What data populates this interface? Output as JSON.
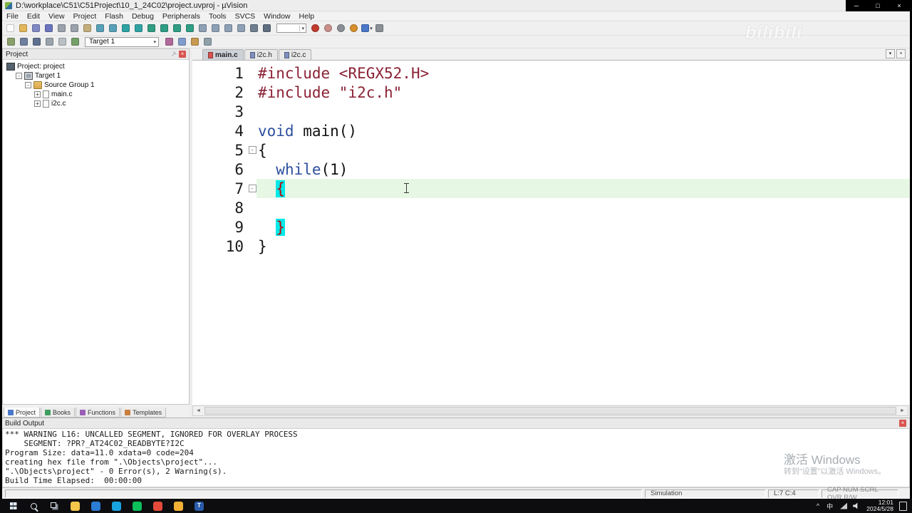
{
  "icons": {
    "minimize": "─",
    "maximize": "□",
    "close": "×",
    "caret_down": "▾",
    "pin": "⊤",
    "scroll_left": "◄",
    "scroll_right": "►",
    "chevron_up": "^"
  },
  "window": {
    "title": "D:\\workplace\\C51\\C51Project\\10_1_24C02\\project.uvproj - µVision"
  },
  "menu": {
    "items": [
      "File",
      "Edit",
      "View",
      "Project",
      "Flash",
      "Debug",
      "Peripherals",
      "Tools",
      "SVCS",
      "Window",
      "Help"
    ]
  },
  "toolbar1": {
    "iconsA": [
      {
        "name": "new-file",
        "color": "#fcfcfc"
      },
      {
        "name": "open-folder",
        "color": "#e3b65a"
      },
      {
        "name": "save",
        "color": "#8089c6"
      },
      {
        "name": "save-all",
        "color": "#6a75bd"
      },
      {
        "name": "cut",
        "color": "#9aa3ac"
      },
      {
        "name": "copy",
        "color": "#9aa3ac"
      },
      {
        "name": "paste",
        "color": "#c4ad7c"
      },
      {
        "name": "undo",
        "color": "#58a0b8"
      },
      {
        "name": "redo",
        "color": "#58a0b8"
      },
      {
        "name": "nav-back",
        "color": "#2fa3a3"
      },
      {
        "name": "nav-forward",
        "color": "#2fa3a3"
      },
      {
        "name": "bookmark-toggle",
        "color": "#2f9e84"
      },
      {
        "name": "bookmark-prev",
        "color": "#2f9e84"
      },
      {
        "name": "bookmark-next",
        "color": "#2f9e84"
      },
      {
        "name": "bookmark-clear-all",
        "color": "#2f9e84"
      },
      {
        "name": "indent-right",
        "color": "#8ea0b5"
      },
      {
        "name": "indent-left",
        "color": "#8ea0b5"
      },
      {
        "name": "comment-selection",
        "color": "#8ea0b5"
      },
      {
        "name": "uncomment-selection",
        "color": "#8ea0b5"
      },
      {
        "name": "find-in-files",
        "color": "#6f7f8f"
      },
      {
        "name": "find",
        "color": "#5f6f7f"
      }
    ],
    "iconsB": [
      {
        "name": "insert-breakpoint",
        "color": "#c23b2e",
        "round": true
      },
      {
        "name": "disable-breakpoint",
        "color": "#c98f8a",
        "round": true
      },
      {
        "name": "kill-all-breakpoints",
        "color": "#8a8f96",
        "round": true
      },
      {
        "name": "enable-all-breakpoints",
        "color": "#d78f2a",
        "round": true
      },
      {
        "name": "debug-windows",
        "color": "#4a78c8",
        "caret": "▾"
      },
      {
        "name": "configure-tools",
        "color": "#8a8f96"
      }
    ]
  },
  "toolbar2": {
    "target": "Target 1",
    "iconsA": [
      {
        "name": "translate-file",
        "color": "#8aa06a"
      },
      {
        "name": "build",
        "color": "#6f7f9f"
      },
      {
        "name": "rebuild-all",
        "color": "#5f7090"
      },
      {
        "name": "batch-build",
        "color": "#9aa3ac"
      },
      {
        "name": "stop-build",
        "color": "#b9bfc5"
      },
      {
        "name": "download-to-flash",
        "color": "#76a06a"
      }
    ],
    "iconsB": [
      {
        "name": "options-for-target",
        "color": "#b06a9a"
      },
      {
        "name": "manage-project-items",
        "color": "#7f9ccc"
      },
      {
        "name": "manage-run-time-environment",
        "color": "#c89a50"
      },
      {
        "name": "file-extensions",
        "color": "#8fa0aa"
      }
    ]
  },
  "project_panel": {
    "title": "Project",
    "tree": [
      {
        "indent": 0,
        "icon": "workspace",
        "label": "Project: project"
      },
      {
        "indent": 1,
        "expander": "-",
        "icon": "target",
        "label": "Target 1"
      },
      {
        "indent": 2,
        "expander": "-",
        "icon": "folder",
        "label": "Source Group 1"
      },
      {
        "indent": 3,
        "expander": "+",
        "icon": "file",
        "label": "main.c"
      },
      {
        "indent": 3,
        "expander": "+",
        "icon": "file",
        "label": "i2c.c"
      }
    ]
  },
  "editor": {
    "tabs": [
      {
        "label": "main.c",
        "active": true,
        "icon": "#d9534f"
      },
      {
        "label": "i2c.h",
        "active": false,
        "icon": "#7f8fbf"
      },
      {
        "label": "i2c.c",
        "active": false,
        "icon": "#7f8fbf"
      }
    ],
    "lines": [
      {
        "num": 1,
        "tokens": [
          {
            "text": "#include ",
            "color": "#8b2235"
          },
          {
            "text": "<REGX52.H>",
            "color": "#8b2235"
          }
        ]
      },
      {
        "num": 2,
        "tokens": [
          {
            "text": "#include ",
            "color": "#8b2235"
          },
          {
            "text": "\"i2c.h\"",
            "color": "#8b2235"
          }
        ]
      },
      {
        "num": 3,
        "tokens": []
      },
      {
        "num": 4,
        "tokens": [
          {
            "text": "void",
            "color": "#2d4f9e"
          },
          {
            "text": " main()"
          }
        ]
      },
      {
        "num": 5,
        "fold": "-",
        "tokens": [
          {
            "text": "{"
          }
        ]
      },
      {
        "num": 6,
        "tokens": [
          {
            "text": "  "
          },
          {
            "text": "while",
            "color": "#2d4f9e"
          },
          {
            "text": "(1)"
          }
        ]
      },
      {
        "num": 7,
        "fold": "-",
        "bg": "#e6f8e4",
        "tokens": [
          {
            "text": "  "
          },
          {
            "text": "{",
            "color": "#c00000",
            "bg": "#00e8e8"
          }
        ]
      },
      {
        "num": 8,
        "tokens": []
      },
      {
        "num": 9,
        "tokens": [
          {
            "text": "  "
          },
          {
            "text": "}",
            "color": "#c00000",
            "bg": "#00e8e8"
          }
        ]
      },
      {
        "num": 10,
        "tokens": [
          {
            "text": "}"
          }
        ]
      }
    ]
  },
  "bottom_tabs": {
    "items": [
      {
        "label": "Project",
        "active": true,
        "icon": "#4a78c8"
      },
      {
        "label": "Books",
        "active": false,
        "icon": "#3f9e5f"
      },
      {
        "label": "Functions",
        "active": false,
        "icon": "#9a5fb5"
      },
      {
        "label": "Templates",
        "active": false,
        "icon": "#c87f3f"
      }
    ]
  },
  "build_output": {
    "title": "Build Output",
    "lines": [
      "*** WARNING L16: UNCALLED SEGMENT, IGNORED FOR OVERLAY PROCESS",
      "    SEGMENT: ?PR?_AT24C02_READBYTE?I2C",
      "Program Size: data=11.0 xdata=0 code=204",
      "creating hex file from \".\\Objects\\project\"...",
      "\".\\Objects\\project\" - 0 Error(s), 2 Warning(s).",
      "Build Time Elapsed:  00:00:00"
    ]
  },
  "status_bar": {
    "mode": "Simulation",
    "cursor": "L:7 C:4",
    "flags": "CAP NUM SCRL OVR R/W"
  },
  "taskbar": {
    "system": [
      {
        "name": "start"
      },
      {
        "name": "search"
      },
      {
        "name": "task-view"
      }
    ],
    "apps": [
      {
        "name": "file-explorer",
        "color": "#f3c64b"
      },
      {
        "name": "browser",
        "color": "#2b7cd3"
      },
      {
        "name": "app-teal",
        "color": "#18a4e0"
      },
      {
        "name": "wechat",
        "color": "#0bbf5a"
      },
      {
        "name": "app-red",
        "color": "#e64a3c"
      },
      {
        "name": "app-yellow",
        "color": "#f2b134"
      },
      {
        "name": "typora",
        "color": "#2a5caa",
        "label": "T"
      }
    ],
    "tray": {
      "chevron": "^",
      "ime": "中",
      "time": "12:01",
      "date": "2024/5/28"
    }
  },
  "watermarks": {
    "bili": "bilibili",
    "activate_line1": "激活 Windows",
    "activate_line2": "转到“设置”以激活 Windows。"
  }
}
